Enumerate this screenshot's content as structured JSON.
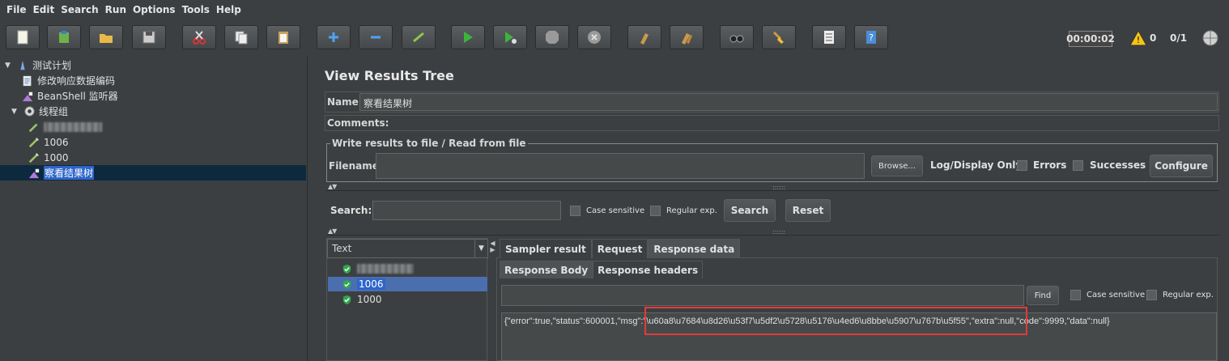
{
  "menu": [
    "File",
    "Edit",
    "Search",
    "Run",
    "Options",
    "Tools",
    "Help"
  ],
  "toolbar": {
    "timer": "00:00:02",
    "warning_count": "0",
    "thread_count": "0/1"
  },
  "tree": {
    "root": "测试计划",
    "items": [
      {
        "label": "修改响应数据编码",
        "icon": "script-icon"
      },
      {
        "label": "BeanShell 监听器",
        "icon": "listener-icon"
      },
      {
        "label": "线程组",
        "icon": "gear-icon"
      }
    ],
    "group_children": [
      {
        "label": "",
        "icon": "sampler-icon",
        "blurred": true
      },
      {
        "label": "1006",
        "icon": "pipette-icon"
      },
      {
        "label": "1000",
        "icon": "pipette-icon"
      },
      {
        "label": "察看结果树",
        "icon": "listener-icon",
        "selected": true
      }
    ]
  },
  "panel": {
    "title": "View Results Tree",
    "name_label": "Name:",
    "name_value": "察看结果树",
    "comments_label": "Comments:",
    "fileset_legend": "Write results to file / Read from file",
    "filename_label": "Filename",
    "browse_label": "Browse...",
    "log_display_label": "Log/Display Only:",
    "errors_label": "Errors",
    "successes_label": "Successes",
    "configure_label": "Configure"
  },
  "search": {
    "label": "Search:",
    "case_label": "Case sensitive",
    "regex_label": "Regular exp.",
    "search_button": "Search",
    "reset_button": "Reset"
  },
  "results": {
    "renderer": "Text",
    "items": [
      {
        "label": "",
        "blurred": true
      },
      {
        "label": "1006",
        "selected": true
      },
      {
        "label": "1000"
      }
    ]
  },
  "tabs": [
    "Sampler result",
    "Request",
    "Response data"
  ],
  "active_tab": "Response data",
  "subtabs": [
    "Response Body",
    "Response headers"
  ],
  "find": {
    "button": "Find",
    "case_label": "Case sensitive",
    "regex_label": "Regular exp."
  },
  "response_body": "{\"error\":true,\"status\":600001,\"msg\":\"\\u60a8\\u7684\\u8d26\\u53f7\\u5df2\\u5728\\u5176\\u4ed6\\u8bbe\\u5907\\u767b\\u5f55\",\"extra\":null,\"code\":9999,\"data\":null}",
  "colors": {
    "selection": "#2f65ca",
    "highlight_box": "#e23b3b",
    "background": "#3c3f41"
  }
}
